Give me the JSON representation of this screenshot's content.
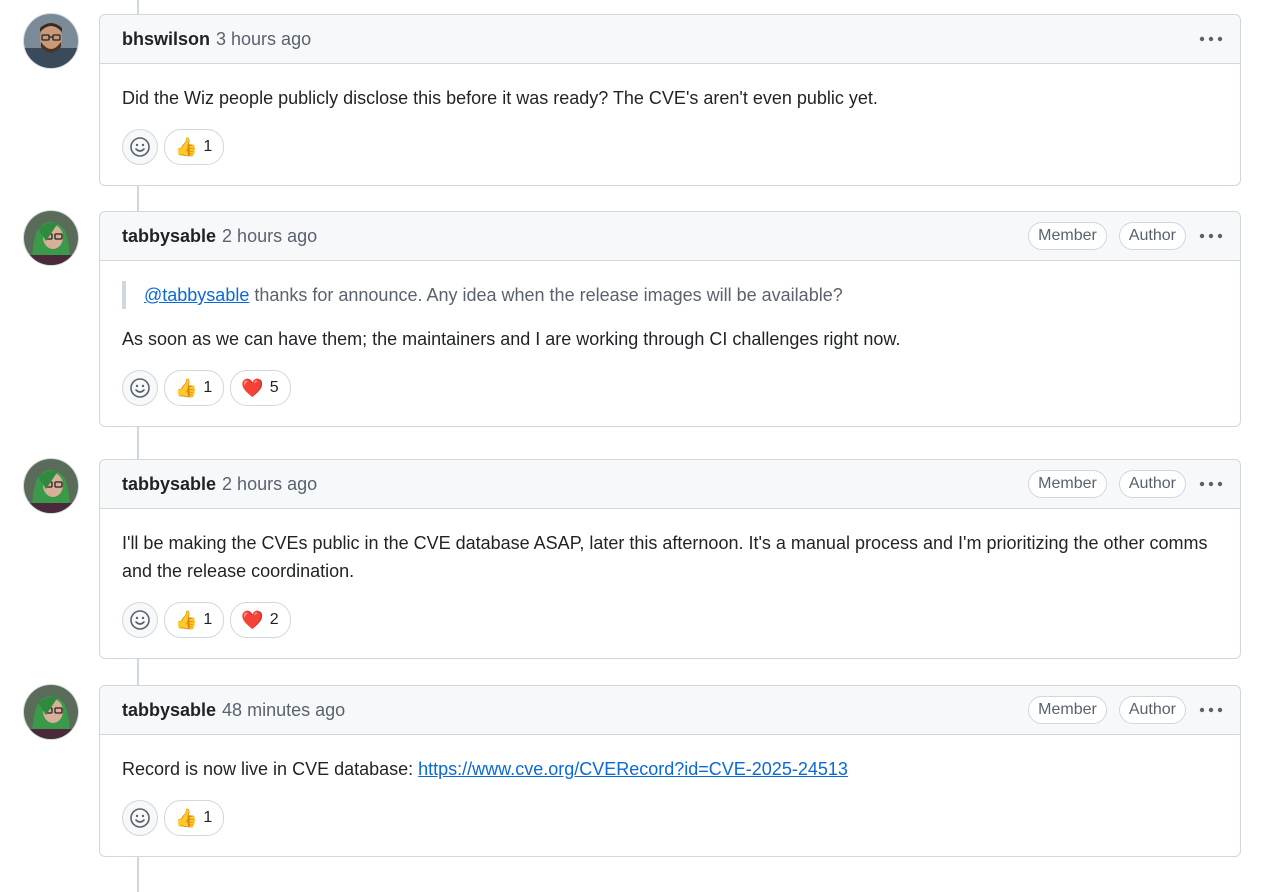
{
  "comments": [
    {
      "author": "bhswilson",
      "time": "3 hours ago",
      "badges": [],
      "quote": null,
      "text": "Did the Wiz people publicly disclose this before it was ready? The CVE's aren't even public yet.",
      "reactions": [
        {
          "emoji": "👍",
          "icon": "thumbs-up-icon",
          "count": "1"
        }
      ]
    },
    {
      "author": "tabbysable",
      "time": "2 hours ago",
      "badges": [
        "Member",
        "Author"
      ],
      "quote": {
        "mention": "@tabbysable",
        "text": " thanks for announce. Any idea when the release images will be available?"
      },
      "text": "As soon as we can have them; the maintainers and I are working through CI challenges right now.",
      "reactions": [
        {
          "emoji": "👍",
          "icon": "thumbs-up-icon",
          "count": "1"
        },
        {
          "emoji": "❤️",
          "icon": "heart-icon",
          "count": "5"
        }
      ]
    },
    {
      "author": "tabbysable",
      "time": "2 hours ago",
      "badges": [
        "Member",
        "Author"
      ],
      "quote": null,
      "text": "I'll be making the CVEs public in the CVE database ASAP, later this afternoon. It's a manual process and I'm prioritizing the other comms and the release coordination.",
      "reactions": [
        {
          "emoji": "👍",
          "icon": "thumbs-up-icon",
          "count": "1"
        },
        {
          "emoji": "❤️",
          "icon": "heart-icon",
          "count": "2"
        }
      ]
    },
    {
      "author": "tabbysable",
      "time": "48 minutes ago",
      "badges": [
        "Member",
        "Author"
      ],
      "quote": null,
      "text_prefix": "Record is now live in CVE database: ",
      "link": "https://www.cve.org/CVERecord?id=CVE-2025-24513",
      "reactions": [
        {
          "emoji": "👍",
          "icon": "thumbs-up-icon",
          "count": "1"
        }
      ]
    }
  ],
  "colors": {
    "link": "#0969da",
    "border": "#d0d7de",
    "header_bg": "#f6f8fa",
    "muted": "#59636e"
  }
}
